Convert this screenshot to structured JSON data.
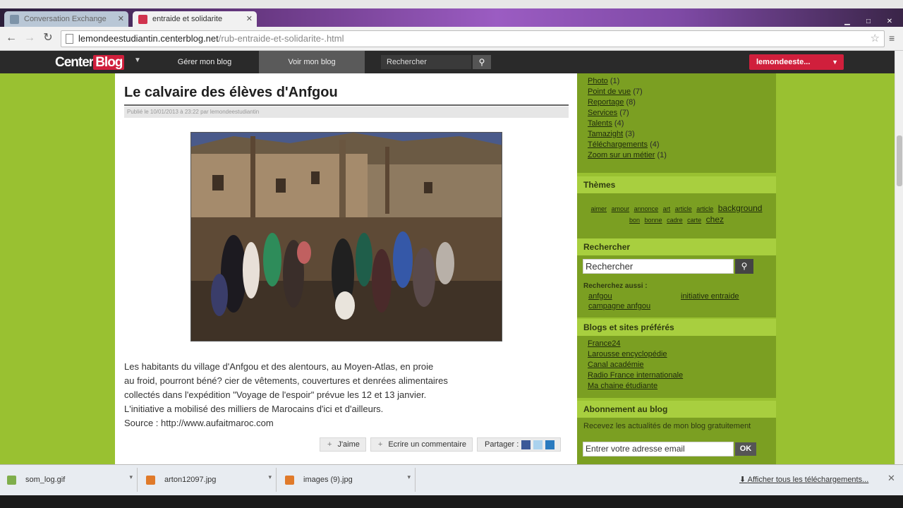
{
  "browser": {
    "tabs": [
      {
        "label": "Conversation Exchange",
        "active": false
      },
      {
        "label": "entraide et solidarite",
        "active": true
      }
    ],
    "url_host": "lemondeestudiantin.centerblog.net",
    "url_path": "/rub-entraide-et-solidarite-.html"
  },
  "centerblog": {
    "logo_center": "Center",
    "logo_blog": "Blog",
    "nav": {
      "manage": "Gérer mon blog",
      "view": "Voir mon blog"
    },
    "search_placeholder": "Rechercher",
    "user": "lemondeeste..."
  },
  "article": {
    "title": "Le calvaire des élèves d'Anfgou",
    "meta": "Publié le 10/01/2013 à 23:22 par lemondeestudiantin",
    "paragraphs": [
      "Les habitants du village d'Anfgou et des alentours, au Moyen-Atlas, en proie",
      "au froid, pourront béné? cier de vêtements, couvertures et denrées alimentaires",
      "collectés dans l'expédition \"Voyage de l'espoir\" prévue les 12 et 13 janvier.",
      "L'initiative a mobilisé des milliers de Marocains d'ici et d'ailleurs.",
      "Source : http://www.aufaitmaroc.com"
    ],
    "actions": {
      "like": "J'aime",
      "comment": "Ecrire un commentaire",
      "share": "Partager :"
    }
  },
  "sidebar": {
    "categories": [
      {
        "name": "Photo",
        "count": "(1)"
      },
      {
        "name": "Point de vue",
        "count": "(7)"
      },
      {
        "name": "Reportage",
        "count": "(8)"
      },
      {
        "name": "Services",
        "count": "(7)"
      },
      {
        "name": "Talents",
        "count": "(4)"
      },
      {
        "name": "Tamazight",
        "count": "(3)"
      },
      {
        "name": "Téléchargements",
        "count": "(4)"
      },
      {
        "name": "Zoom sur un métier",
        "count": "(1)"
      }
    ],
    "themes_title": "Thèmes",
    "themes_line1": [
      "aimer",
      "amour",
      "annonce",
      "art",
      "article",
      "article",
      "background"
    ],
    "themes_line2": [
      "bon",
      "bonne",
      "cadre",
      "carte",
      "chez"
    ],
    "search_title": "Rechercher",
    "search_value": "Rechercher",
    "also_label": "Recherchez aussi :",
    "also_items": [
      "anfgou",
      "initiative entraide",
      "campagne anfgou"
    ],
    "favorites_title": "Blogs et sites préférés",
    "favorites": [
      "France24",
      "Larousse encyclopédie",
      "Canal académie",
      "Radio France internationale",
      "Ma chaine étudiante"
    ],
    "subscribe_title": "Abonnement au blog",
    "subscribe_text": "Recevez les actualités de mon blog gratuitement",
    "email_placeholder": "Entrer votre adresse email",
    "ok": "OK"
  },
  "downloads": {
    "items": [
      "som_log.gif",
      "arton12097.jpg",
      "images (9).jpg"
    ],
    "show_all": "Afficher tous les téléchargements..."
  },
  "colors": {
    "page_bg": "#99c131",
    "sidebar_block": "#7b9f22",
    "sidebar_head": "#a8cf3f",
    "brand_red": "#d01f3c"
  }
}
